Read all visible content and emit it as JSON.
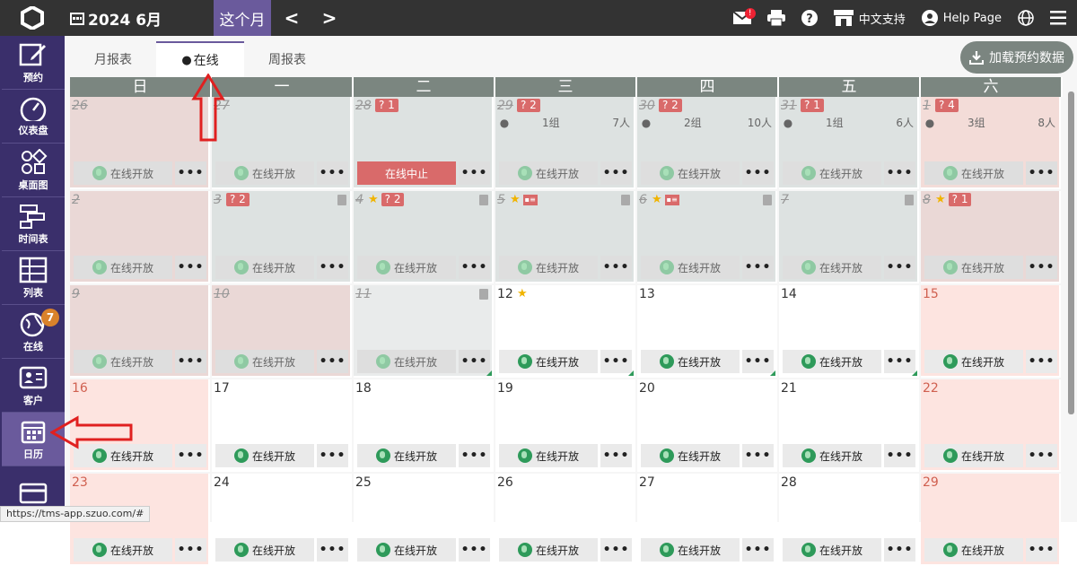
{
  "header": {
    "month_title": "2024 6月",
    "this_month": "这个月",
    "prev": "<",
    "next": ">",
    "right": {
      "lang_label": "中文支持",
      "help_label": "Help Page"
    },
    "message_badge": "!"
  },
  "sidebar": {
    "items": [
      {
        "label": "预约",
        "icon": "edit-icon"
      },
      {
        "label": "仪表盘",
        "icon": "gauge-icon"
      },
      {
        "label": "桌面图",
        "icon": "shapes-icon"
      },
      {
        "label": "时间表",
        "icon": "timeline-icon"
      },
      {
        "label": "列表",
        "icon": "table-icon"
      },
      {
        "label": "在线",
        "icon": "globe-icon",
        "badge": "7"
      },
      {
        "label": "客户",
        "icon": "contact-card-icon"
      },
      {
        "label": "日历",
        "icon": "calendar-icon"
      },
      {
        "label": "",
        "icon": "card-icon"
      }
    ]
  },
  "tabs": [
    {
      "label": "月报表"
    },
    {
      "label": "在线"
    },
    {
      "label": "周报表"
    }
  ],
  "load_button": "加载预约数据",
  "week_header": [
    "日",
    "一",
    "二",
    "三",
    "四",
    "五",
    "六"
  ],
  "labels": {
    "open": "在线开放",
    "stop": "在线中止",
    "more": "•••",
    "group_unit": "组",
    "people_unit": "人"
  },
  "weeks": [
    [
      {
        "day": "26",
        "struck": true,
        "tag": "",
        "info": null
      },
      {
        "day": "27",
        "struck": true,
        "tag": "",
        "info": null
      },
      {
        "day": "28",
        "struck": true,
        "tag": "? 1",
        "info": null,
        "stopped": true
      },
      {
        "day": "29",
        "struck": true,
        "tag": "? 2",
        "info": {
          "groups": "1组",
          "people": "7人"
        }
      },
      {
        "day": "30",
        "struck": true,
        "tag": "? 2",
        "info": {
          "groups": "2组",
          "people": "10人"
        }
      },
      {
        "day": "31",
        "struck": true,
        "tag": "? 1",
        "info": {
          "groups": "1组",
          "people": "6人"
        }
      },
      {
        "day": "1",
        "struck": true,
        "tag": "? 4",
        "info": {
          "groups": "3组",
          "people": "8人"
        }
      }
    ],
    [
      {
        "day": "2",
        "struck": true,
        "tag": ""
      },
      {
        "day": "3",
        "struck": true,
        "tag": "? 2"
      },
      {
        "day": "4",
        "struck": true,
        "tag": "? 2",
        "star": true
      },
      {
        "day": "5",
        "struck": true,
        "tag": "",
        "star": true,
        "card": true
      },
      {
        "day": "6",
        "struck": true,
        "tag": "",
        "star": true,
        "card": true
      },
      {
        "day": "7",
        "struck": true,
        "tag": ""
      },
      {
        "day": "8",
        "struck": true,
        "tag": "? 1",
        "star": true
      }
    ],
    [
      {
        "day": "9",
        "struck": true
      },
      {
        "day": "10",
        "struck": true
      },
      {
        "day": "11",
        "struck": true
      },
      {
        "day": "12",
        "struck": false,
        "star": true
      },
      {
        "day": "13",
        "struck": false
      },
      {
        "day": "14",
        "struck": false
      },
      {
        "day": "15",
        "struck": false
      }
    ],
    [
      {
        "day": "16"
      },
      {
        "day": "17"
      },
      {
        "day": "18"
      },
      {
        "day": "19"
      },
      {
        "day": "20"
      },
      {
        "day": "21"
      },
      {
        "day": "22"
      }
    ],
    [
      {
        "day": "23"
      },
      {
        "day": "24"
      },
      {
        "day": "25"
      },
      {
        "day": "26"
      },
      {
        "day": "27"
      },
      {
        "day": "28"
      },
      {
        "day": "29"
      }
    ]
  ],
  "status_url": "https://tms-app.szuo.com/#",
  "colors": {
    "sidebar": "#3a2f6b",
    "accent": "#6a5a9c",
    "topbar": "#333333",
    "open_green": "#2e9a5a",
    "stop_red": "#d96a6a"
  }
}
